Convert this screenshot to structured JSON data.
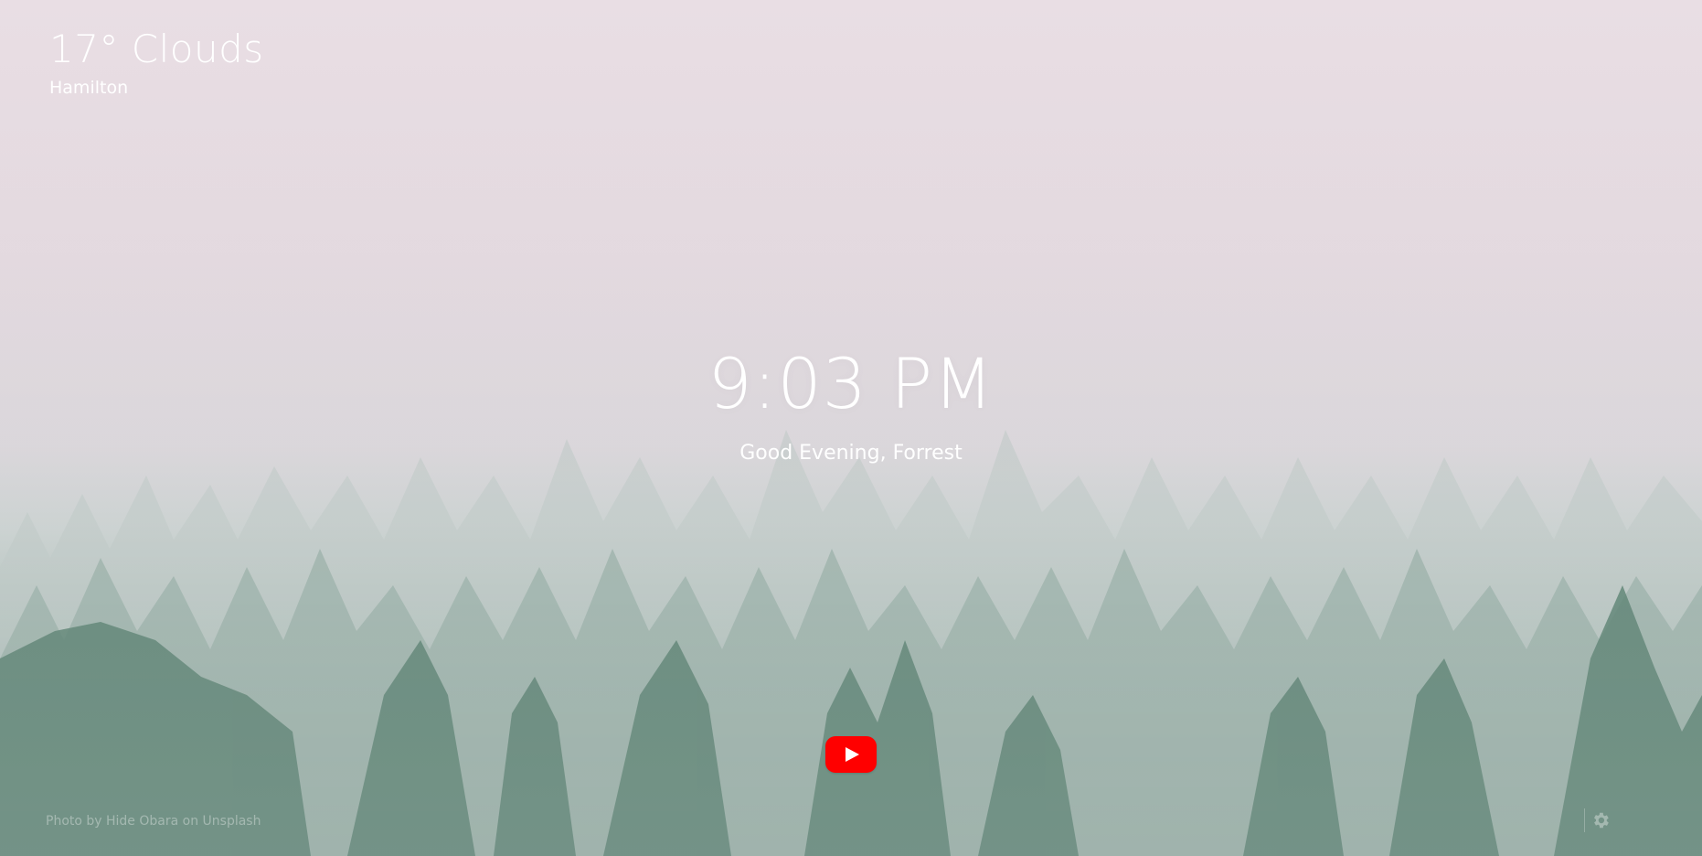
{
  "weather": {
    "summary": "17° Clouds",
    "location": "Hamilton"
  },
  "clock": {
    "time": "9:03 PM",
    "greeting": "Good Evening, Forrest"
  },
  "footer": {
    "photo_credit": "Photo by Hide Obara on Unsplash"
  },
  "icons": {
    "media": "youtube-play-icon",
    "settings": "gear-icon"
  },
  "colors": {
    "youtube_red": "#ff0000",
    "text": "#ffffff",
    "sky": "#e9dee4",
    "forest": "#5d8273"
  }
}
